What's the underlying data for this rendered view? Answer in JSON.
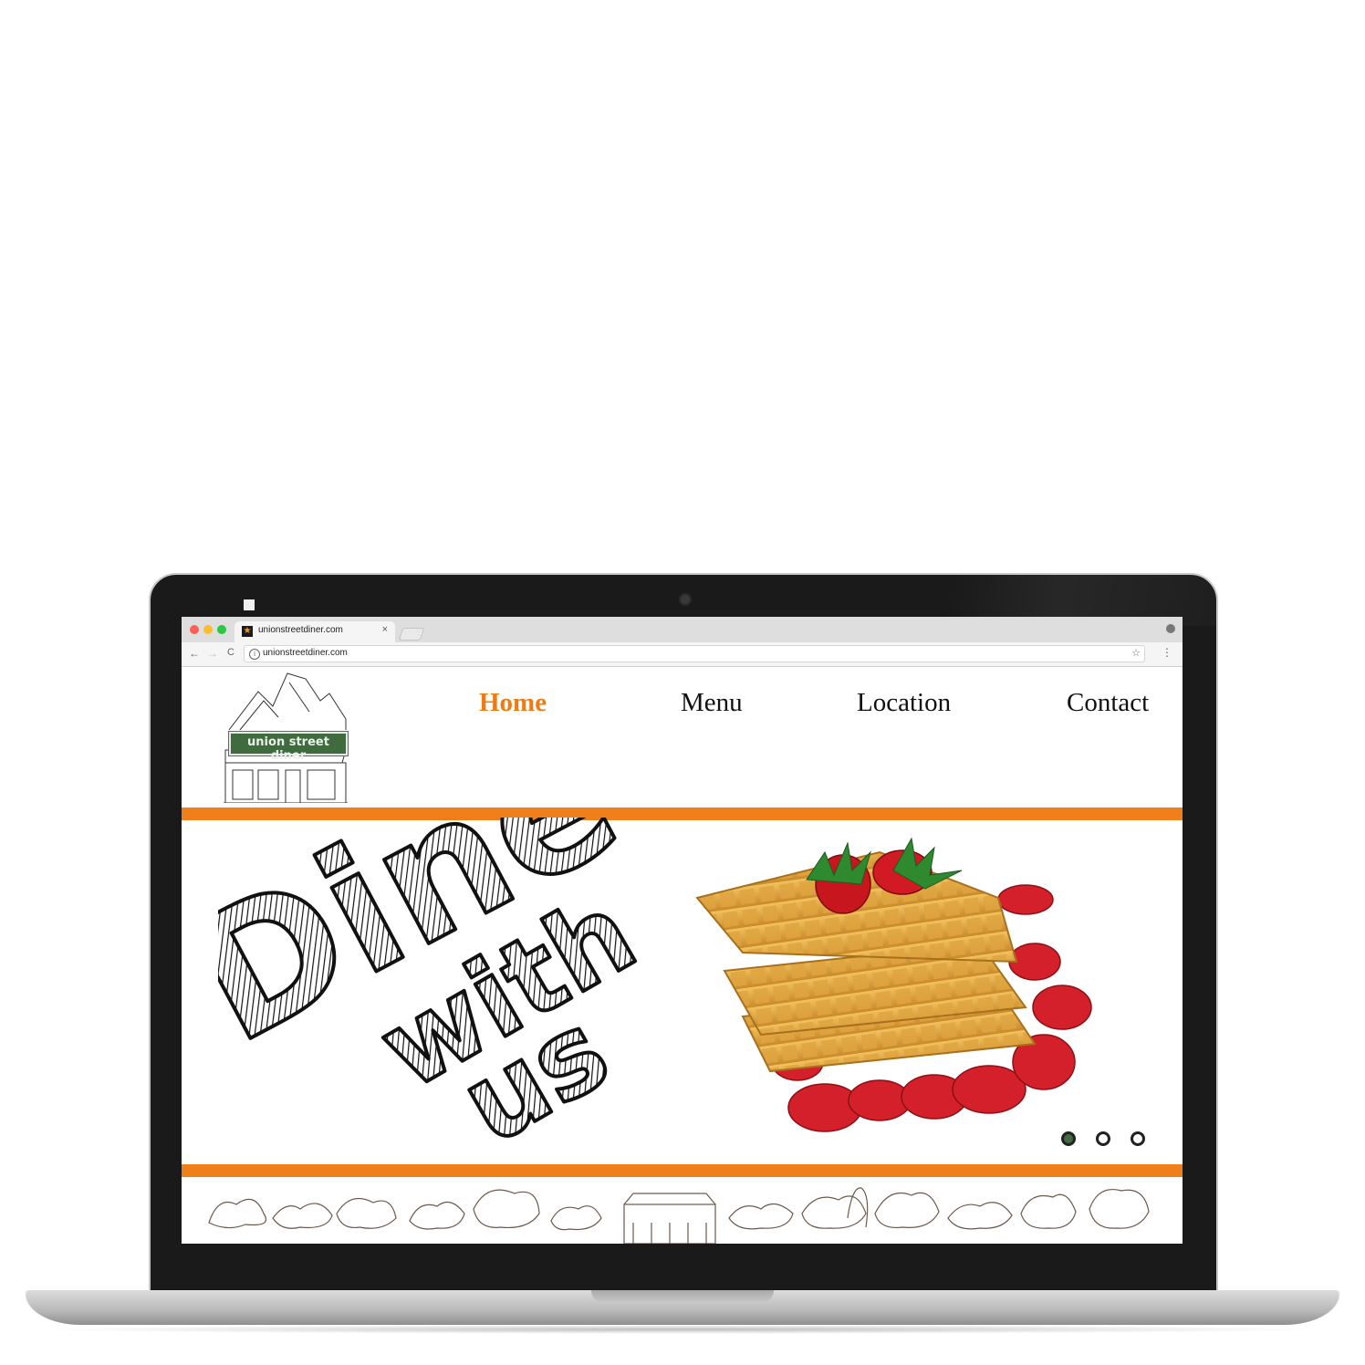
{
  "browser": {
    "tab_title": "unionstreetdiner.com",
    "tab_close": "×",
    "url": "unionstreetdiner.com",
    "back_icon": "←",
    "forward_icon": "→",
    "reload_icon": "C",
    "star_icon": "☆",
    "menu_icon": "⋮",
    "info_icon": "i",
    "favicon": "★"
  },
  "site": {
    "logo_text": "union street diner",
    "nav": {
      "home": "Home",
      "menu": "Menu",
      "location": "Location",
      "contact": "Contact"
    },
    "hero": {
      "line1": "Dine",
      "line2": "with",
      "line3": "us"
    },
    "slider": {
      "count": 3,
      "active_index": 0
    }
  },
  "colors": {
    "accent": "#ef7f1a",
    "brand_green": "#3f6b3f",
    "text": "#111111"
  }
}
